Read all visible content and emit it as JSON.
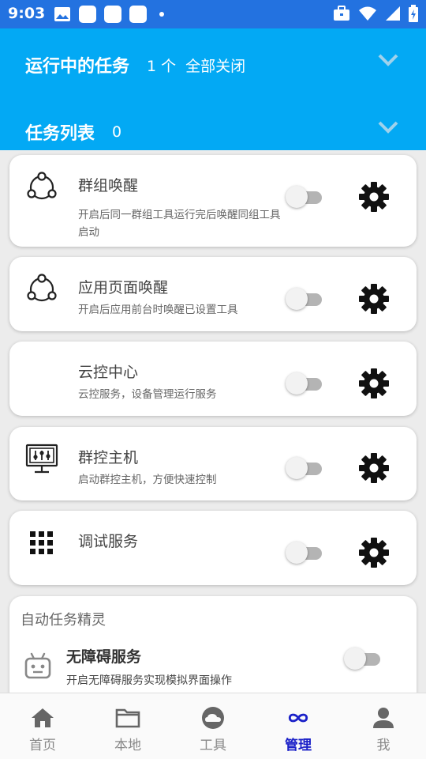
{
  "status_bar": {
    "time": "9:03"
  },
  "header": {
    "running_title": "运行中的任务",
    "running_count": "1 个",
    "close_all": "全部关闭",
    "task_list_title": "任务列表",
    "task_list_count": "0"
  },
  "cards": [
    {
      "name": "群组唤醒",
      "desc": "开启后同一群组工具运行完后唤醒同组工具启动",
      "enabled": false,
      "icon": "cycle-icon"
    },
    {
      "name": "应用页面唤醒",
      "desc": "开启后应用前台时唤醒已设置工具",
      "enabled": false,
      "icon": "cycle-icon"
    },
    {
      "name": "云控中心",
      "desc": "云控服务，设备管理运行服务",
      "enabled": false,
      "icon": "none"
    },
    {
      "name": "群控主机",
      "desc": "启动群控主机，方便快速控制",
      "enabled": false,
      "icon": "monitor-sliders-icon"
    },
    {
      "name": "调试服务",
      "desc": "",
      "enabled": false,
      "icon": "grid-icon"
    }
  ],
  "auto_section": {
    "title": "自动任务精灵",
    "row_name": "无障碍服务",
    "row_desc": "开启无障碍服务实现模拟界面操作",
    "enabled": false
  },
  "bottom_nav": [
    {
      "label": "首页",
      "icon": "home-icon",
      "active": false
    },
    {
      "label": "本地",
      "icon": "folder-icon",
      "active": false
    },
    {
      "label": "工具",
      "icon": "cloud-icon",
      "active": false
    },
    {
      "label": "管理",
      "icon": "infinity-icon",
      "active": true
    },
    {
      "label": "我",
      "icon": "person-icon",
      "active": false
    }
  ],
  "colors": {
    "status_bar": "#2372e0",
    "header": "#03a9f4",
    "nav_active": "#1a20c8"
  }
}
